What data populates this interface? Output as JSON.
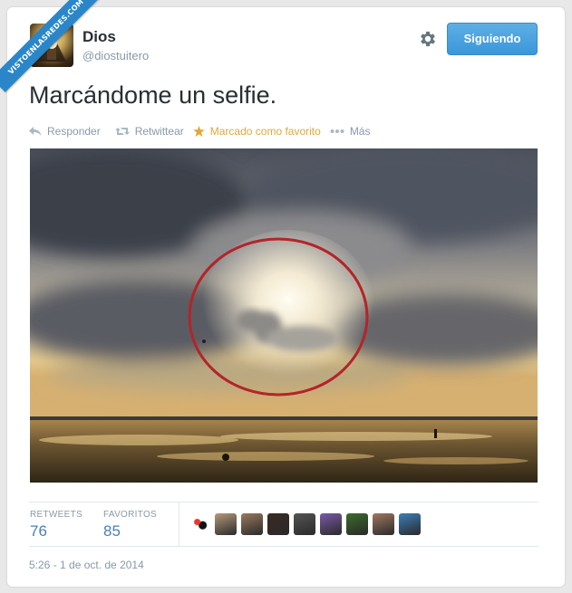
{
  "watermark": "VISTOENLASREDES.COM",
  "user": {
    "name": "Dios",
    "handle": "@diostuitero"
  },
  "follow_button": "Siguiendo",
  "tweet": {
    "text": "Marcándome un selfie."
  },
  "actions": [
    {
      "label": "Responder",
      "icon": "reply-icon"
    },
    {
      "label": "Retwittear",
      "icon": "retweet-icon"
    },
    {
      "label": "Marcado como favorito",
      "icon": "star-icon"
    },
    {
      "label": "Más",
      "icon": "more-icon"
    }
  ],
  "stats": {
    "retweets_label": "RETWEETS",
    "retweets_value": "76",
    "favorites_label": "FAVORITOS",
    "favorites_value": "85"
  },
  "favorited_by_colors": [
    "#ffffff",
    "#b59a7a",
    "#9a7a5e",
    "#3a2a22",
    "#555555",
    "#7a5aa8",
    "#3b6b2a",
    "#a0785f",
    "#3b7fb8"
  ],
  "timestamp": "5:26 - 1 de oct. de 2014",
  "colors": {
    "accent": "#4aa3df",
    "favorite": "#e2a73d",
    "muted": "#8899a6",
    "stat_value": "#4a7fb3"
  }
}
